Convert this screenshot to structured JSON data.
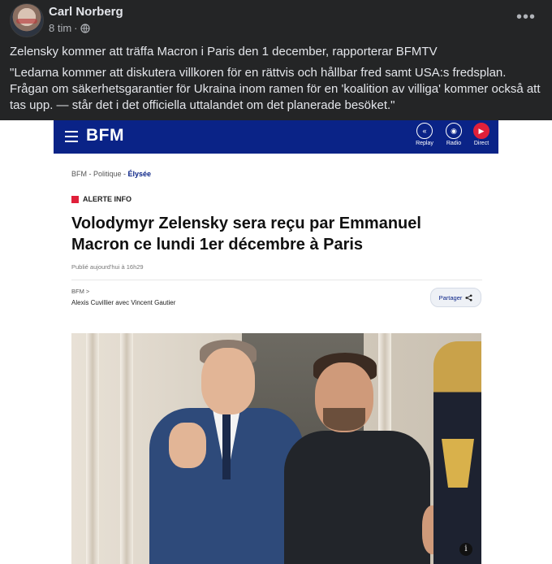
{
  "post": {
    "author": "Carl Norberg",
    "time": "8 tim",
    "separator": "·",
    "privacy_icon": "globe-icon",
    "menu_icon": "more-dots-icon",
    "text_line1": "Zelensky kommer att träffa Macron i Paris den 1 december, rapporterar BFMTV",
    "text_quote": "\"Ledarna kommer att diskutera villkoren för en rättvis och hållbar fred samt USA:s fredsplan. Frågan om säkerhetsgarantier för Ukraina inom ramen för en 'koalition av villiga' kommer också att tas upp. — står det i det officiella uttalandet om det planerade besöket.\""
  },
  "article": {
    "logo": "BFM",
    "nav": [
      {
        "label": "Replay",
        "icon": "replay-icon"
      },
      {
        "label": "Radio",
        "icon": "radio-icon"
      },
      {
        "label": "Direct",
        "icon": "live-tv-icon"
      }
    ],
    "breadcrumb_prefix": "BFM - Politique - ",
    "breadcrumb_last": "Élysée",
    "alert_label": "ALERTE INFO",
    "headline": "Volodymyr Zelensky sera reçu par Emmanuel Macron ce lundi 1er décembre à Paris",
    "published": "Publié aujourd'hui à 16h29",
    "source": "BFM >",
    "authors": "Alexis Cuvillier avec Vincent Gautier",
    "share_label": "Partager",
    "info_icon": "info-icon",
    "brand_color": "#0a2387",
    "alert_color": "#e0203a"
  }
}
